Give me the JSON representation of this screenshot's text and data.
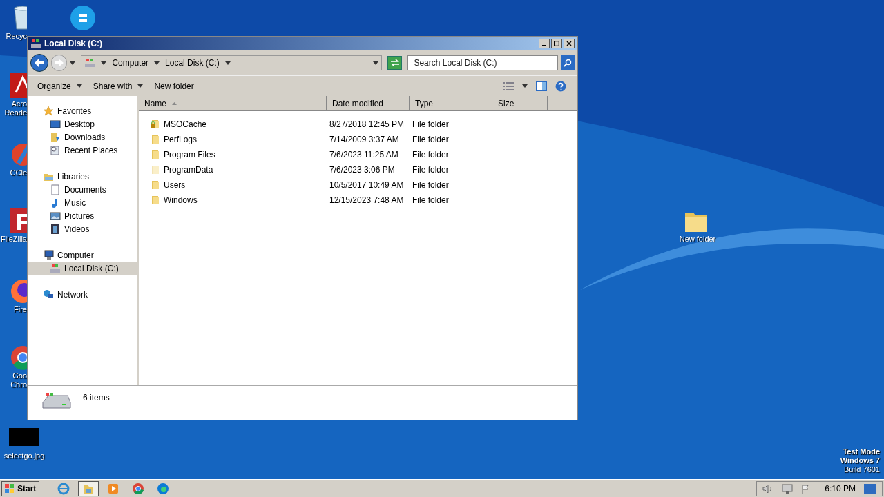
{
  "desktop_icons": [
    {
      "kind": "recycle-bin",
      "lines": [
        "Recyc"
      ]
    },
    {
      "kind": "chat"
    },
    {
      "kind": "pdf",
      "lines": [
        "Acro",
        "Reade"
      ]
    },
    {
      "kind": "brush",
      "lines": [
        "CCle"
      ]
    },
    {
      "kind": "ftp",
      "lines": [
        "FileZilla"
      ]
    },
    {
      "kind": "fox",
      "lines": [
        "Fire"
      ]
    },
    {
      "kind": "globe",
      "lines": [
        "Goo",
        "Chro"
      ]
    },
    {
      "kind": "image",
      "lines": [
        "selectgo.jpg"
      ]
    },
    {
      "kind": "folder",
      "lines": [
        "New folder"
      ]
    }
  ],
  "window": {
    "title": "Local Disk (C:)",
    "breadcrumb": [
      "Computer",
      "Local Disk (C:)"
    ],
    "search": {
      "placeholder": "Search Local Disk (C:)"
    },
    "toolbar": [
      {
        "label": "Organize",
        "dropdown": true
      },
      {
        "label": "Share with",
        "dropdown": true
      },
      {
        "label": "New folder",
        "dropdown": false
      }
    ],
    "sidebar": [
      {
        "label": "Favorites",
        "kind": "star",
        "selected": false,
        "children": [
          {
            "label": "Desktop",
            "kind": "desktop",
            "selected": false
          },
          {
            "label": "Downloads",
            "kind": "download",
            "selected": false
          },
          {
            "label": "Recent Places",
            "kind": "recent",
            "selected": false
          }
        ]
      },
      {
        "label": "Libraries",
        "kind": "library",
        "selected": false,
        "children": [
          {
            "label": "Documents",
            "kind": "document",
            "selected": false
          },
          {
            "label": "Music",
            "kind": "music",
            "selected": false
          },
          {
            "label": "Pictures",
            "kind": "picture",
            "selected": false
          },
          {
            "label": "Videos",
            "kind": "video",
            "selected": false
          }
        ]
      },
      {
        "label": "Computer",
        "kind": "computer",
        "selected": false,
        "children": [
          {
            "label": "Local Disk (C:)",
            "kind": "drive",
            "selected": true
          }
        ]
      },
      {
        "label": "Network",
        "kind": "network",
        "selected": false
      }
    ],
    "columns": [
      {
        "label": "Name",
        "sorted": true
      },
      {
        "label": "Date modified",
        "sorted": false
      },
      {
        "label": "Type",
        "sorted": false
      },
      {
        "label": "Size",
        "sorted": false
      }
    ],
    "rows": [
      {
        "name": "MSOCache",
        "date": "8/27/2018 12:45 PM",
        "type": "File folder",
        "kind": "locked"
      },
      {
        "name": "PerfLogs",
        "date": "7/14/2009 3:37 AM",
        "type": "File folder",
        "kind": "normal"
      },
      {
        "name": "Program Files",
        "date": "7/6/2023 11:25 AM",
        "type": "File folder",
        "kind": "normal"
      },
      {
        "name": "ProgramData",
        "date": "7/6/2023 3:06 PM",
        "type": "File folder",
        "kind": "hidden"
      },
      {
        "name": "Users",
        "date": "10/5/2017 10:49 AM",
        "type": "File folder",
        "kind": "normal"
      },
      {
        "name": "Windows",
        "date": "12/15/2023 7:48 AM",
        "type": "File folder",
        "kind": "normal"
      }
    ],
    "status": "6 items"
  },
  "system_info": [
    "Test Mode",
    "Windows 7",
    "Build 7601"
  ],
  "taskbar": {
    "start": "Start",
    "apps": [
      {
        "kind": "ie",
        "selected": false
      },
      {
        "kind": "explorer",
        "selected": true
      },
      {
        "kind": "player",
        "selected": false
      },
      {
        "kind": "chrome",
        "selected": false
      },
      {
        "kind": "edge",
        "selected": false
      }
    ],
    "time": "6:10 PM"
  }
}
